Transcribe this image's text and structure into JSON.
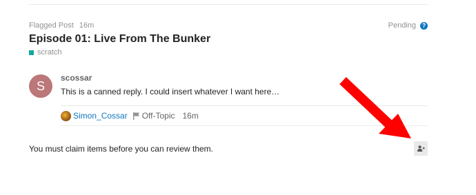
{
  "review": {
    "type_label": "Flagged Post",
    "time": "16m",
    "status": "Pending",
    "help_icon": "question-circle-icon"
  },
  "topic": {
    "title": "Episode 01: Live From The Bunker",
    "category": "scratch",
    "category_color": "#12a89d"
  },
  "post": {
    "avatar_letter": "S",
    "avatar_color": "#bc7779",
    "username": "scossar",
    "body": "This is a canned reply. I could insert whatever I want here…"
  },
  "flag_info": {
    "flagged_by": "Simon_Cossar",
    "flag_icon": "flag-icon",
    "reason": "Off-Topic",
    "time": "16m"
  },
  "claim": {
    "message": "You must claim items before you can review them.",
    "button_icon": "user-plus-icon"
  },
  "annotation": {
    "arrow_color": "#ff0000"
  }
}
